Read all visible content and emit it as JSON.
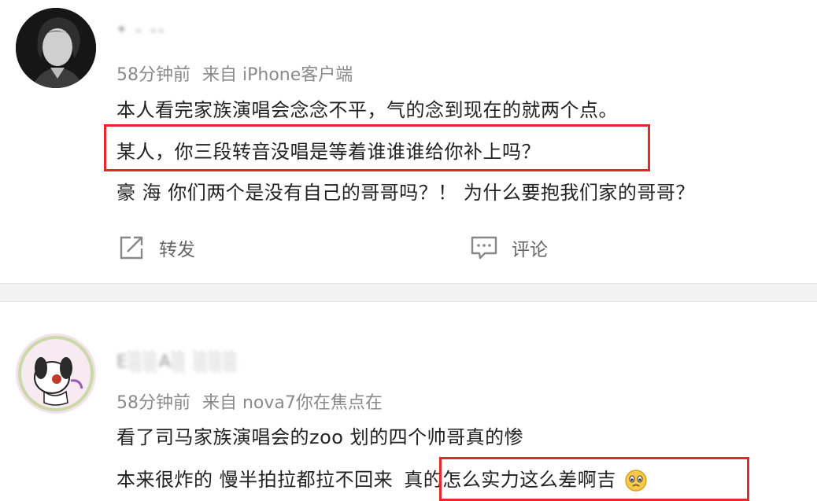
{
  "posts": [
    {
      "username": "•  ‐   ‐‐",
      "time": "58分钟前",
      "source": "来自 iPhone客户端",
      "lines": [
        "本人看完家族演唱会念念不平，气的念到现在的就两个点。",
        "某人，你三段转音没唱是等着谁谁谁给你补上吗？",
        "豪 海 你们两个是没有自己的哥哥吗？！ 为什么要抱我们家的哥哥？"
      ],
      "actions": {
        "repost": "转发",
        "comment": "评论"
      }
    },
    {
      "username": "E░░A░  ░░░",
      "time": "58分钟前",
      "source": "来自 nova7你在焦点在",
      "lines": [
        "看了司马家族演唱会的zoo 划的四个帅哥真的惨",
        "本来很炸的 慢半拍拉都拉不回来",
        "真的怎么实力这么差啊吉"
      ]
    }
  ],
  "colors": {
    "highlight": "#e8272c",
    "meta": "#8a8a8a",
    "text": "#222222",
    "divider": "#f2f2f2"
  }
}
